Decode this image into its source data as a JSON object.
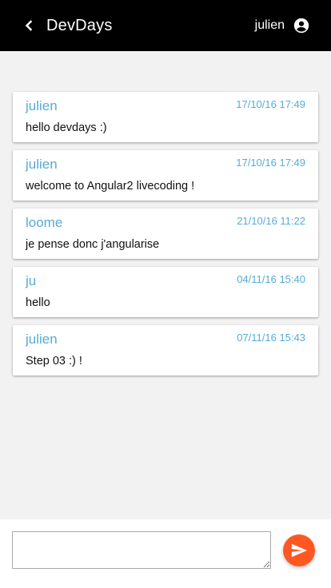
{
  "header": {
    "title": "DevDays",
    "user": "julien",
    "back_icon": "chevron-left-icon",
    "account_icon": "account-circle-icon"
  },
  "messages": [
    {
      "author": "julien",
      "time": "17/10/16 17:49",
      "text": "hello devdays :)"
    },
    {
      "author": "julien",
      "time": "17/10/16 17:49",
      "text": "welcome to Angular2 livecoding !"
    },
    {
      "author": "loome",
      "time": "21/10/16 11:22",
      "text": "je pense donc j'angularise"
    },
    {
      "author": "ju",
      "time": "04/11/16 15:40",
      "text": "hello"
    },
    {
      "author": "julien",
      "time": "07/11/16 15:43",
      "text": "Step 03 :) !"
    }
  ],
  "composer": {
    "value": "",
    "send_icon": "send-icon"
  },
  "colors": {
    "header_bg": "#000000",
    "accent": "#55acd6",
    "send_button": "#ff5722",
    "background": "#f2f2f2"
  }
}
